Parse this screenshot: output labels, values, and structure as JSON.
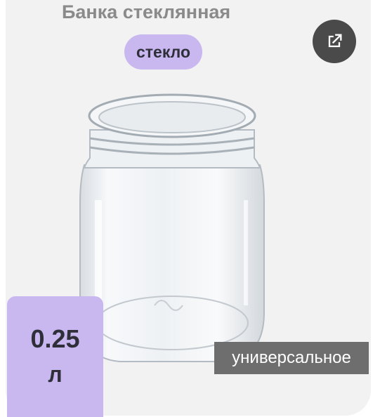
{
  "product": {
    "title": "Банка стеклянная",
    "material": "стекло",
    "volume_value": "0.25",
    "volume_unit": "л",
    "usage": "универсальное"
  },
  "icons": {
    "open_external": "external-link-icon",
    "product_image": "glass-jar-image"
  },
  "colors": {
    "card_background": "#f2f2f2",
    "accent_lavender": "#c9b7ef",
    "title_text": "#8a8a8a",
    "dark_button": "#4a4a4a",
    "usage_label_bg": "#6e6e6e"
  }
}
